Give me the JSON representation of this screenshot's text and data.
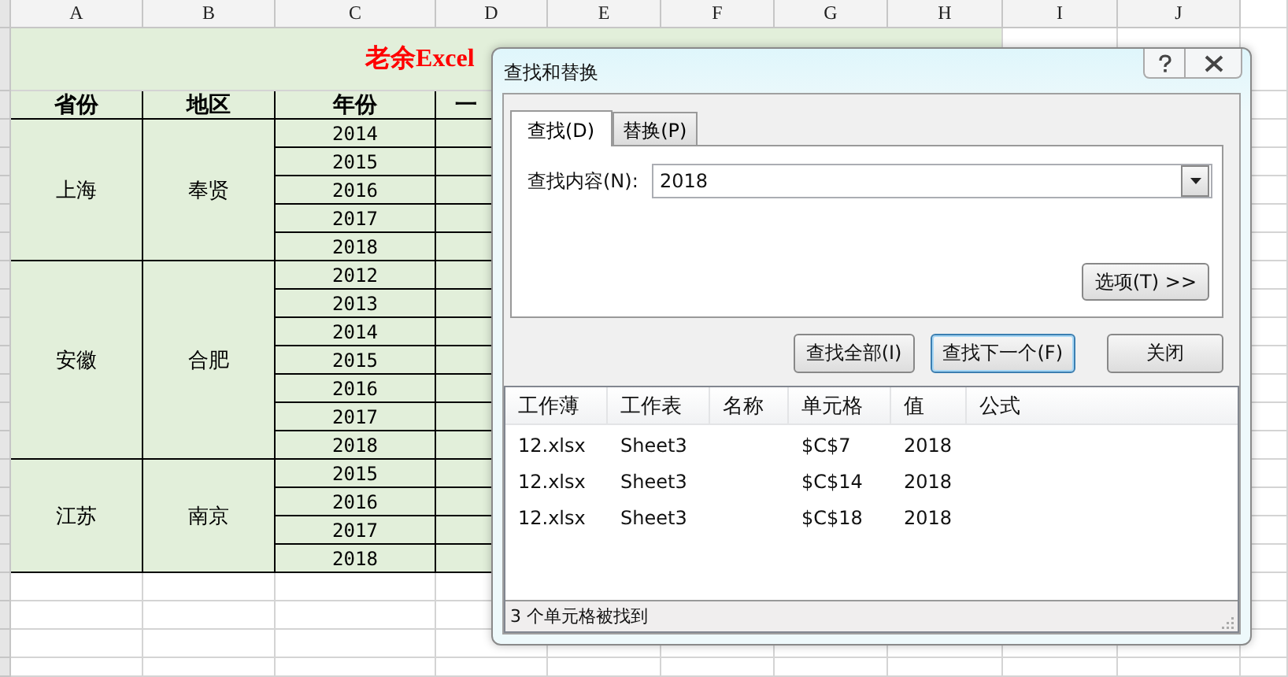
{
  "sheet": {
    "columns": [
      "A",
      "B",
      "C",
      "D",
      "E",
      "F",
      "G",
      "H",
      "I",
      "J"
    ],
    "title": "老余Excel",
    "headers": [
      "省份",
      "地区",
      "年份",
      "一"
    ],
    "groups": [
      {
        "province": "上海",
        "region": "奉贤",
        "years": [
          "2014",
          "2015",
          "2016",
          "2017",
          "2018"
        ]
      },
      {
        "province": "安徽",
        "region": "合肥",
        "years": [
          "2012",
          "2013",
          "2014",
          "2015",
          "2016",
          "2017",
          "2018"
        ]
      },
      {
        "province": "江苏",
        "region": "南京",
        "years": [
          "2015",
          "2016",
          "2017",
          "2018"
        ]
      }
    ]
  },
  "dialog": {
    "title": "查找和替换",
    "tabs": [
      {
        "label": "查找(D)",
        "selected": true
      },
      {
        "label": "替换(P)",
        "selected": false
      }
    ],
    "find_label": "查找内容(N):",
    "find_value": "2018",
    "options_button": "选项(T) >>",
    "buttons": [
      {
        "label": "查找全部(I)",
        "default": false
      },
      {
        "label": "查找下一个(F)",
        "default": true
      },
      {
        "label": "关闭",
        "default": false
      }
    ],
    "results": {
      "columns": [
        "工作薄",
        "工作表",
        "名称",
        "单元格",
        "值",
        "公式"
      ],
      "rows": [
        [
          "12.xlsx",
          "Sheet3",
          "",
          "$C$7",
          "2018",
          ""
        ],
        [
          "12.xlsx",
          "Sheet3",
          "",
          "$C$14",
          "2018",
          ""
        ],
        [
          "12.xlsx",
          "Sheet3",
          "",
          "$C$18",
          "2018",
          ""
        ]
      ]
    },
    "status": "3 个单元格被找到"
  }
}
